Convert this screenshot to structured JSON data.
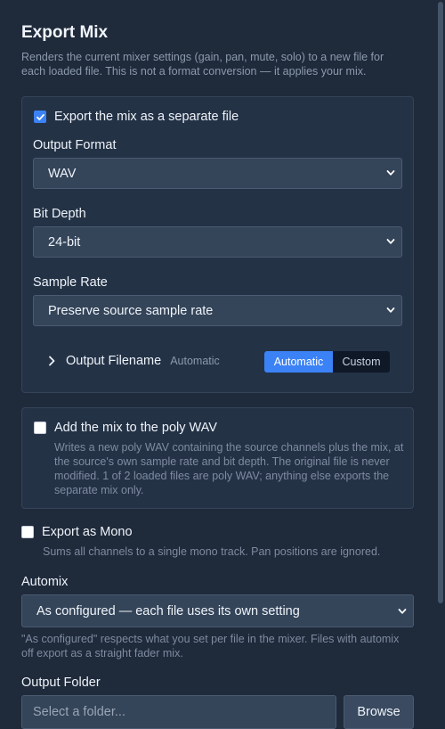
{
  "dialog": {
    "title": "Export Mix",
    "description": "Renders the current mixer settings (gain, pan, mute, solo) to a new file for each loaded file. This is not a format conversion — it applies your mix."
  },
  "separate_file": {
    "checkbox_label": "Export the mix as a separate file",
    "checked": true,
    "output_format": {
      "label": "Output Format",
      "value": "WAV"
    },
    "bit_depth": {
      "label": "Bit Depth",
      "value": "24-bit"
    },
    "sample_rate": {
      "label": "Sample Rate",
      "value": "Preserve source sample rate"
    },
    "output_filename": {
      "label": "Output Filename",
      "current": "Automatic",
      "options": [
        "Automatic",
        "Custom"
      ],
      "selected": "Automatic"
    }
  },
  "poly_wav": {
    "checkbox_label": "Add the mix to the poly WAV",
    "checked": false,
    "help": "Writes a new poly WAV containing the source channels plus the mix, at the source's own sample rate and bit depth. The original file is never modified. 1 of 2 loaded files are poly WAV; anything else exports the separate mix only."
  },
  "mono": {
    "checkbox_label": "Export as Mono",
    "checked": false,
    "help": "Sums all channels to a single mono track. Pan positions are ignored."
  },
  "automix": {
    "label": "Automix",
    "value": "As configured — each file uses its own setting",
    "help": "\"As configured\" respects what you set per file in the mixer. Files with automix off export as a straight fader mix."
  },
  "output_folder": {
    "label": "Output Folder",
    "placeholder": "Select a folder...",
    "browse_label": "Browse"
  },
  "colors": {
    "background": "#1f2a3b",
    "card": "#243246",
    "accent": "#3b82f6"
  }
}
